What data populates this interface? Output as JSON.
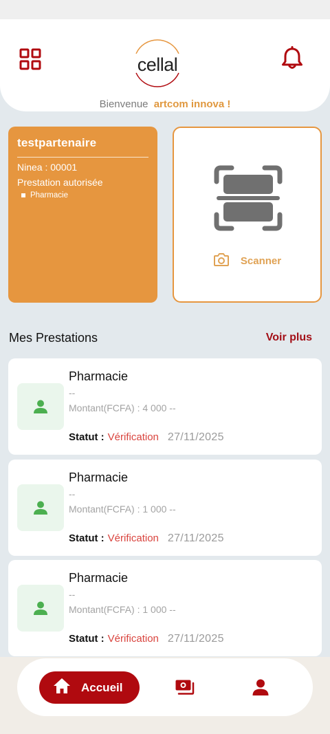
{
  "header": {
    "brand": "cellal",
    "welcome_prefix": "Bienvenue",
    "welcome_user": "artcom innova !"
  },
  "partner": {
    "name": "testpartenaire",
    "ninea": "Ninea : 00001",
    "prestation_title": "Prestation autorisée",
    "prestations": [
      "Pharmacie"
    ]
  },
  "scan": {
    "label": "Scanner"
  },
  "section": {
    "title": "Mes Prestations",
    "see_more": "Voir plus"
  },
  "items": [
    {
      "title": "Pharmacie",
      "sub": "--",
      "amount": "Montant(FCFA) : 4 000 --",
      "status_label": "Statut :",
      "status_value": "Vérification",
      "date": "27/11/2025"
    },
    {
      "title": "Pharmacie",
      "sub": "--",
      "amount": "Montant(FCFA) : 1 000 --",
      "status_label": "Statut :",
      "status_value": "Vérification",
      "date": "27/11/2025"
    },
    {
      "title": "Pharmacie",
      "sub": "--",
      "amount": "Montant(FCFA) : 1 000 --",
      "status_label": "Statut :",
      "status_value": "Vérification",
      "date": "27/11/2025"
    }
  ],
  "nav": {
    "home_label": "Accueil",
    "home_icon": "home-icon",
    "money_icon": "money-icon",
    "profile_icon": "profile-icon"
  },
  "colors": {
    "brand_red": "#b00a0f",
    "accent_orange": "#e6963f",
    "status_red": "#d9433d",
    "avatar_green": "#4caf50"
  }
}
